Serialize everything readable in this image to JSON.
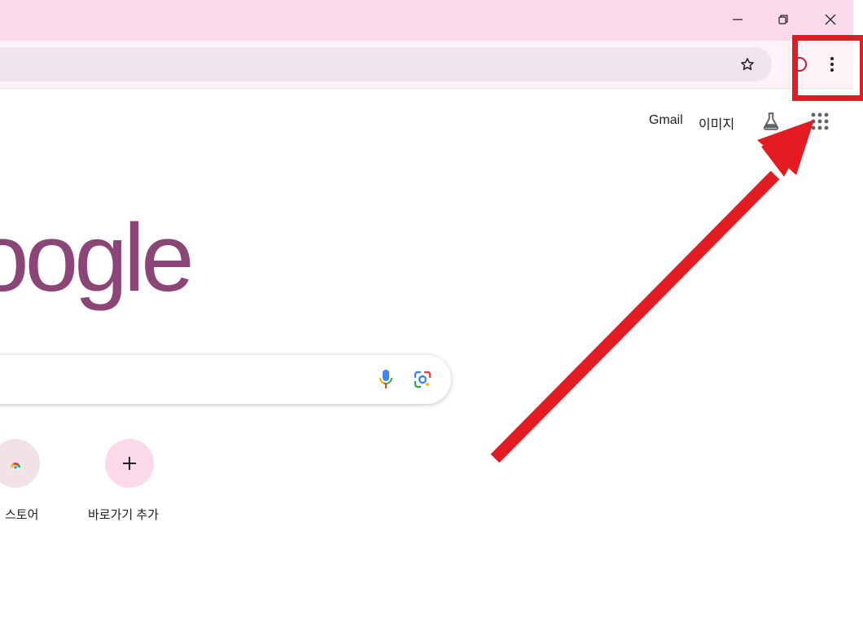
{
  "window": {
    "controls": [
      "minimize-icon",
      "restore-icon",
      "close-icon"
    ]
  },
  "toolbar": {
    "omnibox_value": "",
    "icons": [
      "star-icon",
      "extension-icon",
      "more-vert-icon"
    ]
  },
  "google": {
    "links": {
      "gmail": "Gmail",
      "images": "이미지"
    },
    "logo_text": "oogle",
    "logo_color": "#8c4577",
    "search_value": ""
  },
  "shortcuts": [
    {
      "label": "스토어"
    },
    {
      "label": "바로가기 추가"
    }
  ],
  "colors": {
    "titlebar": "#fbd9ea",
    "highlight": "#e31b23",
    "add_tile": "#fbd9ea"
  }
}
